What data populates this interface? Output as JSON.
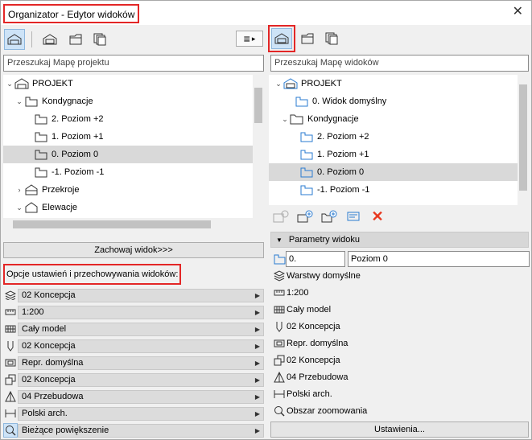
{
  "window": {
    "title": "Organizator - Edytor widoków",
    "close_glyph": "✕"
  },
  "left_toolbar": {
    "menu_glyph": "≡",
    "menu_arrow": "▸"
  },
  "left_panel": {
    "search_placeholder": "Przeszukaj Mapę projektu",
    "tree": [
      {
        "label": "PROJEKT",
        "level": 0,
        "icon": "project-icon",
        "expanded": true
      },
      {
        "label": "Kondygnacje",
        "level": 1,
        "icon": "storey-folder-icon",
        "expanded": true
      },
      {
        "label": "2. Poziom +2",
        "level": 2,
        "icon": "storey-icon"
      },
      {
        "label": "1. Poziom +1",
        "level": 2,
        "icon": "storey-icon"
      },
      {
        "label": "0. Poziom 0",
        "level": 2,
        "icon": "storey-icon",
        "selected": true
      },
      {
        "label": "-1. Poziom -1",
        "level": 2,
        "icon": "storey-icon"
      },
      {
        "label": "Przekroje",
        "level": 1,
        "icon": "section-icon",
        "expanded": false
      },
      {
        "label": "Elewacje",
        "level": 1,
        "icon": "elevation-icon",
        "expanded": true
      }
    ],
    "save_view_button": "Zachowaj widok>>>",
    "options_label": "Opcje ustawień i przechowywania widoków:",
    "options": [
      {
        "icon": "layers-icon",
        "value": "02 Koncepcja"
      },
      {
        "icon": "scale-icon",
        "value": "1:200"
      },
      {
        "icon": "structure-icon",
        "value": "Cały model"
      },
      {
        "icon": "pen-set-icon",
        "value": "02 Koncepcja"
      },
      {
        "icon": "model-view-icon",
        "value": "Repr. domyślna"
      },
      {
        "icon": "graphic-override-icon",
        "value": "02 Koncepcja"
      },
      {
        "icon": "renovation-icon",
        "value": "04 Przebudowa"
      },
      {
        "icon": "dimension-icon",
        "value": "Polski arch."
      },
      {
        "icon": "zoom-icon",
        "value": "Bieżące powiększenie"
      }
    ]
  },
  "right_panel": {
    "search_placeholder": "Przeszukaj Mapę widoków",
    "tree": [
      {
        "label": "PROJEKT",
        "level": 0,
        "icon": "project-icon",
        "expanded": true
      },
      {
        "label": "0. Widok domyślny",
        "level": 1,
        "icon": "storey-icon"
      },
      {
        "label": "Kondygnacje",
        "level": 1,
        "icon": "folder-icon",
        "expanded": true
      },
      {
        "label": "2. Poziom +2",
        "level": 2,
        "icon": "storey-icon"
      },
      {
        "label": "1. Poziom +1",
        "level": 2,
        "icon": "storey-icon"
      },
      {
        "label": "0. Poziom 0",
        "level": 2,
        "icon": "storey-icon",
        "selected": true
      },
      {
        "label": "-1. Poziom -1",
        "level": 2,
        "icon": "storey-icon"
      }
    ],
    "delete_glyph": "✕",
    "view_params": {
      "header": "Parametry widoku",
      "id_value": "0.",
      "name_value": "Poziom 0",
      "props": [
        {
          "icon": "layers-icon",
          "value": "Warstwy domyślne"
        },
        {
          "icon": "scale-icon",
          "value": "1:200"
        },
        {
          "icon": "structure-icon",
          "value": "Cały model"
        },
        {
          "icon": "pen-set-icon",
          "value": "02 Koncepcja"
        },
        {
          "icon": "model-view-icon",
          "value": "Repr. domyślna"
        },
        {
          "icon": "graphic-override-icon",
          "value": "02 Koncepcja"
        },
        {
          "icon": "renovation-icon",
          "value": "04 Przebudowa"
        },
        {
          "icon": "dimension-icon",
          "value": "Polski arch."
        },
        {
          "icon": "zoom-icon",
          "value": "Obszar zoomowania"
        }
      ],
      "settings_button": "Ustawienia..."
    }
  },
  "colors": {
    "highlight": "#e32626",
    "selection": "#d9d9d9",
    "accent_blue": "#2a7bd1",
    "delete_red": "#e8381f"
  }
}
